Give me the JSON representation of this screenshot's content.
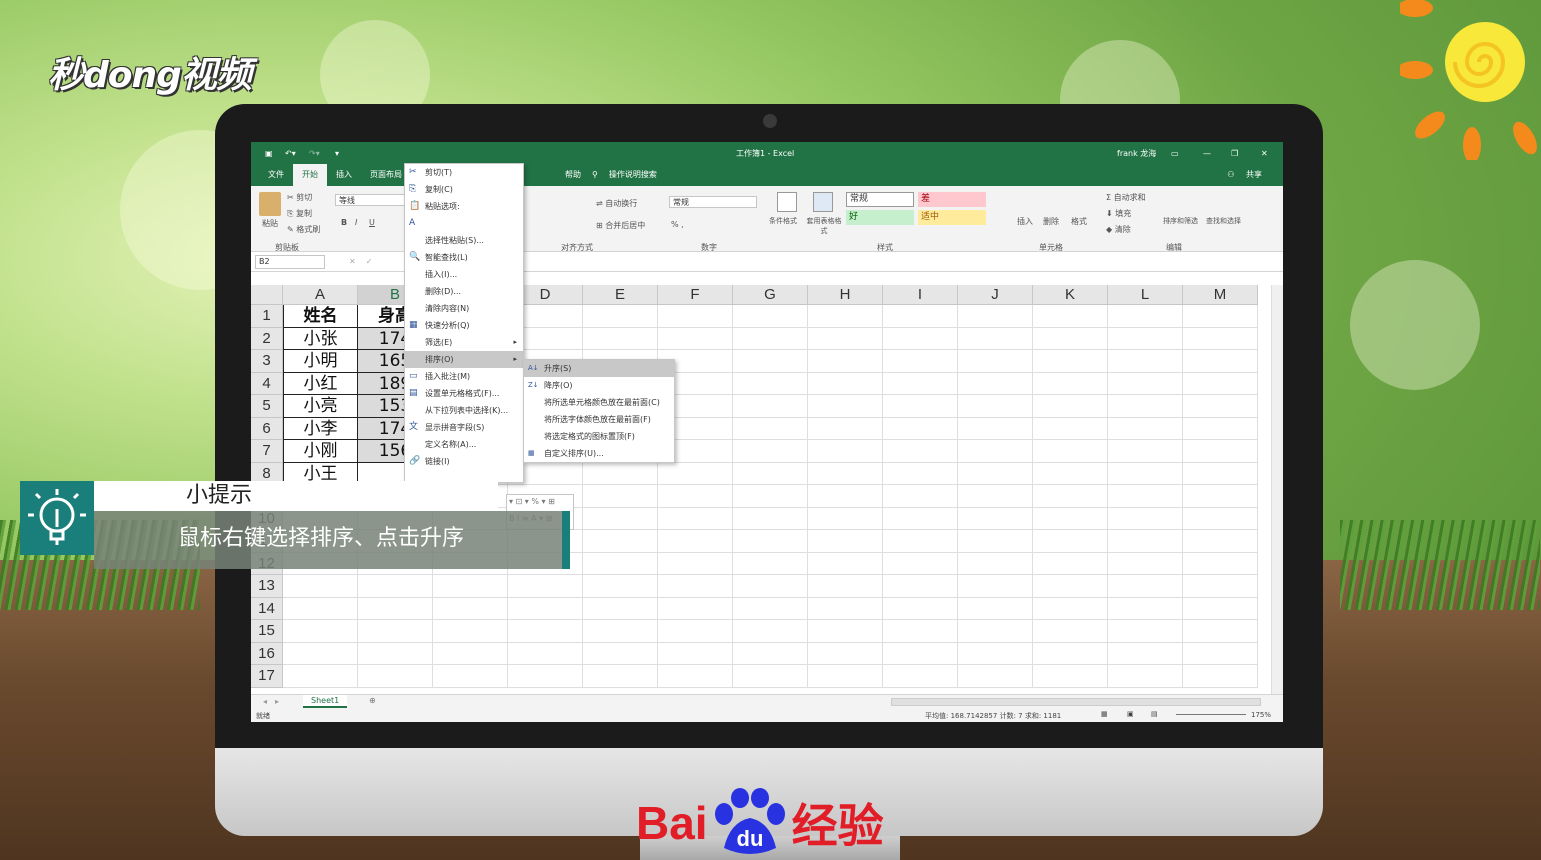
{
  "brand_logo": "秒dong视频",
  "excel": {
    "title": "工作簿1 - Excel",
    "user": "frank 龙海",
    "tabs": [
      "文件",
      "开始",
      "插入",
      "页面布局",
      "帮助"
    ],
    "tell_me": "操作说明搜索",
    "share": "共享",
    "ribbon": {
      "paste": "粘贴",
      "cut": "剪切",
      "copy": "复制",
      "format_painter": "格式刷",
      "clipboard_group": "剪贴板",
      "font_name": "等线",
      "wrap_text": "自动换行",
      "merge_center": "合并后居中",
      "alignment_group": "对齐方式",
      "number_format": "常规",
      "number_group": "数字",
      "conditional_format": "条件格式",
      "format_as_table": "套用表格格式",
      "style_normal": "常规",
      "style_bad": "差",
      "style_good": "好",
      "style_neutral": "适中",
      "styles_group": "样式",
      "insert": "插入",
      "delete": "删除",
      "format": "格式",
      "cells_group": "单元格",
      "autosum": "自动求和",
      "fill": "填充",
      "clear": "清除",
      "sort_filter": "排序和筛选",
      "find_select": "查找和选择",
      "editing_group": "编辑"
    },
    "name_box": "B2",
    "columns": [
      "A",
      "B",
      "C",
      "D",
      "E",
      "F",
      "G",
      "H",
      "I",
      "J",
      "K",
      "L",
      "M"
    ],
    "rows": [
      "1",
      "2",
      "3",
      "4",
      "5",
      "6",
      "7",
      "8",
      "9",
      "10",
      "11",
      "12",
      "13",
      "14",
      "15",
      "16",
      "17"
    ],
    "cells_a": [
      "姓名",
      "小张",
      "小明",
      "小红",
      "小亮",
      "小李",
      "小刚",
      "小王"
    ],
    "cells_b": [
      "身高",
      "174",
      "165",
      "189",
      "153",
      "174",
      "156"
    ],
    "sheet_tab": "Sheet1",
    "status_ready": "就绪",
    "status_stats": "平均值: 168.7142857   计数: 7   求和: 1181",
    "zoom": "175%"
  },
  "context_menu": {
    "items": [
      {
        "label": "剪切(T)",
        "icon": "✂"
      },
      {
        "label": "复制(C)",
        "icon": "⎘"
      },
      {
        "label": "粘贴选项:",
        "icon": "📋"
      },
      {
        "label": "",
        "icon": "A"
      },
      {
        "label": "选择性粘贴(S)...",
        "icon": ""
      },
      {
        "label": "智能查找(L)",
        "icon": "🔍"
      },
      {
        "label": "插入(I)...",
        "icon": ""
      },
      {
        "label": "删除(D)...",
        "icon": ""
      },
      {
        "label": "清除内容(N)",
        "icon": ""
      },
      {
        "label": "快速分析(Q)",
        "icon": "▦"
      },
      {
        "label": "筛选(E)",
        "icon": ""
      },
      {
        "label": "排序(O)",
        "icon": ""
      },
      {
        "label": "插入批注(M)",
        "icon": "▭"
      },
      {
        "label": "设置单元格格式(F)...",
        "icon": "▤"
      },
      {
        "label": "从下拉列表中选择(K)...",
        "icon": ""
      },
      {
        "label": "显示拼音字段(S)",
        "icon": "文"
      },
      {
        "label": "定义名称(A)...",
        "icon": ""
      },
      {
        "label": "链接(I)",
        "icon": "🔗"
      }
    ]
  },
  "sort_submenu": {
    "items": [
      {
        "label": "升序(S)",
        "icon": "A↓"
      },
      {
        "label": "降序(O)",
        "icon": "Z↓"
      },
      {
        "label": "将所选单元格颜色放在最前面(C)",
        "icon": ""
      },
      {
        "label": "将所选字体颜色放在最前面(F)",
        "icon": ""
      },
      {
        "label": "将选定格式的图标置顶(F)",
        "icon": ""
      },
      {
        "label": "自定义排序(U)...",
        "icon": "▦"
      }
    ]
  },
  "tip": {
    "title": "小提示",
    "body": "鼠标右键选择排序、点击升序"
  },
  "footer_brand": {
    "left": "Bai",
    "paw": "du",
    "right": "经验"
  }
}
